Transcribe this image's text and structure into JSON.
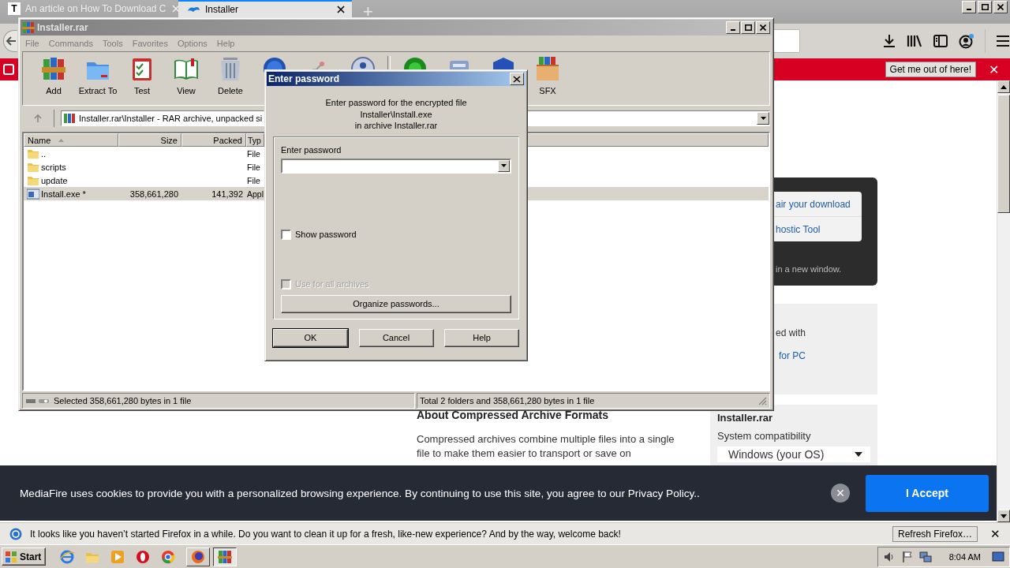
{
  "browser": {
    "tabs": [
      {
        "favicon_letter": "T",
        "title": "An article on How To Download C",
        "selected": false
      },
      {
        "title": "Installer",
        "selected": true
      }
    ],
    "new_tab": "+",
    "notification": {
      "button": "Get me out of here!",
      "close": "✕"
    },
    "page": {
      "sidebar_links": [
        "air your download",
        "hostic Tool"
      ],
      "sidebar_note": "in a new window.",
      "card_text": "ed with",
      "card_link": "for PC",
      "file_name": "Installer.rar",
      "compat_label": "System compatibility",
      "os_select": "Windows (your OS)",
      "article_heading": "About Compressed Archive Formats",
      "article_text": "Compressed archives combine multiple files into a single file to make them easier to transport or save on"
    },
    "cookie_banner": {
      "text": "MediaFire uses cookies to provide you with a personalized browsing experience. By continuing to use this site, you agree to our Privacy Policy..",
      "button": "I Accept",
      "close": "×"
    },
    "firefox_bar": {
      "text": "It looks like you haven’t started Firefox in a while. Do you want to clean it up for a fresh, like-new experience? And by the way, welcome back!",
      "button": "Refresh Firefox…",
      "close": "✕"
    }
  },
  "winrar": {
    "title": "Installer.rar",
    "menu": [
      "File",
      "Commands",
      "Tools",
      "Favorites",
      "Options",
      "Help"
    ],
    "toolbar": [
      "Add",
      "Extract To",
      "Test",
      "View",
      "Delete"
    ],
    "toolbar_end": [
      "SFX"
    ],
    "path": "Installer.rar\\Installer - RAR archive, unpacked si",
    "columns": [
      "Name",
      "Size",
      "Packed",
      "Typ"
    ],
    "rows": [
      {
        "kind": "folder",
        "name": "..",
        "type": "File",
        "selected": false
      },
      {
        "kind": "folder",
        "name": "scripts",
        "type": "File",
        "selected": false
      },
      {
        "kind": "folder",
        "name": "update",
        "type": "File",
        "selected": false
      },
      {
        "kind": "file",
        "name": "Install.exe *",
        "size": "358,661,280",
        "packed": "141,392",
        "type": "Appl",
        "selected": true
      }
    ],
    "status": [
      "Selected 358,661,280 bytes in 1 file",
      "Total 2 folders and 358,661,280 bytes in 1 file"
    ]
  },
  "dialog": {
    "title": "Enter password",
    "message": [
      "Enter password for the encrypted file",
      "Installer\\Install.exe",
      "in archive Installer.rar"
    ],
    "field_label": "Enter password",
    "options": [
      {
        "label": "Show password",
        "checked": false,
        "disabled": false
      },
      {
        "label": "Use for all archives",
        "checked": false,
        "disabled": true
      }
    ],
    "organize_button": "Organize passwords...",
    "buttons": [
      {
        "label": "OK",
        "default": true
      },
      {
        "label": "Cancel",
        "default": false
      },
      {
        "label": "Help",
        "default": false
      }
    ]
  },
  "taskbar": {
    "start": "Start",
    "windows": [
      {
        "selected": false
      },
      {
        "selected": true
      }
    ],
    "clock": "8:04 AM"
  }
}
